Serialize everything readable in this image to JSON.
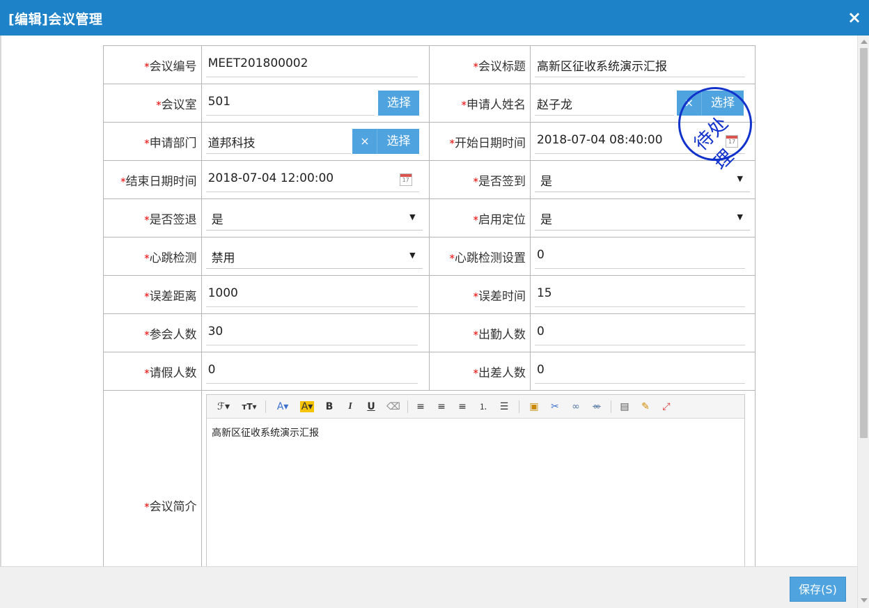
{
  "window": {
    "title": "[编辑]会议管理",
    "close_glyph": "×"
  },
  "fields": {
    "meeting_no": {
      "label": "会议编号",
      "value": "MEET201800002"
    },
    "meeting_title": {
      "label": "会议标题",
      "value": "高新区征收系统演示汇报"
    },
    "meeting_room": {
      "label": "会议室",
      "value": "501"
    },
    "applicant": {
      "label": "申请人姓名",
      "value": "赵子龙"
    },
    "department": {
      "label": "申请部门",
      "value": "道邦科技"
    },
    "start_time": {
      "label": "开始日期时间",
      "value": "2018-07-04 08:40:00"
    },
    "end_time": {
      "label": "结束日期时间",
      "value": "2018-07-04 12:00:00"
    },
    "sign_in": {
      "label": "是否签到",
      "value": "是"
    },
    "sign_out": {
      "label": "是否签退",
      "value": "是"
    },
    "locate": {
      "label": "启用定位",
      "value": "是"
    },
    "heartbeat": {
      "label": "心跳检测",
      "value": "禁用"
    },
    "heartbeat_setting": {
      "label": "心跳检测设置",
      "value": "0"
    },
    "error_distance": {
      "label": "误差距离",
      "value": "1000"
    },
    "error_time": {
      "label": "误差时间",
      "value": "15"
    },
    "attendees": {
      "label": "参会人数",
      "value": "30"
    },
    "present": {
      "label": "出勤人数",
      "value": "0"
    },
    "leave": {
      "label": "请假人数",
      "value": "0"
    },
    "business_trip": {
      "label": "出差人数",
      "value": "0"
    },
    "summary": {
      "label": "会议简介",
      "value": "高新区征收系统演示汇报"
    }
  },
  "required_mark": "*",
  "buttons": {
    "select": "选择",
    "clear": "×",
    "save": "保存(S)"
  },
  "select_arrow": "▼",
  "stamp": {
    "text": "待处理",
    "color": "#1133cc"
  },
  "editor_toolbar": {
    "font_family": "ℱ▾",
    "font_size": "тT▾",
    "font_color": "A▾",
    "bg_color": "A▾",
    "bold": "B",
    "italic": "I",
    "underline": "U",
    "eraser": "⌫",
    "align_left": "≡",
    "align_center": "≡",
    "align_right": "≡",
    "ordered_list": "⒈",
    "unordered_list": "☰",
    "image": "▣",
    "cut": "✂",
    "link": "∞",
    "unlink": "∞",
    "paste": "▤",
    "clean": "✎",
    "fullscreen": "⤢"
  },
  "colors": {
    "titlebar": "#1e82c8",
    "button": "#4fa3de",
    "required": "#e60000"
  }
}
